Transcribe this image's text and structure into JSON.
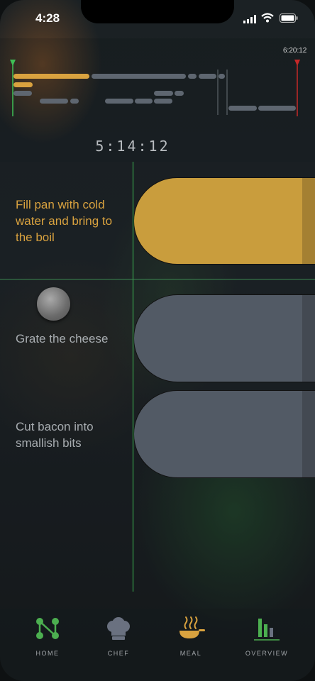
{
  "status_bar": {
    "time": "4:28"
  },
  "timeline": {
    "end_label": "6:20:12",
    "elapsed": "5:14:12",
    "colors": {
      "start_marker": "#3fbf55",
      "end_marker": "#c62828",
      "active_bar": "#d9a23f",
      "pending_bar": "#5e6670"
    }
  },
  "tasks": [
    {
      "label": "Fill pan with cold water and bring to the boil",
      "state": "active",
      "color": "#c99d3d"
    },
    {
      "label": "Grate the cheese",
      "state": "pending",
      "color": "#525a65"
    },
    {
      "label": "Cut bacon into smallish bits",
      "state": "pending",
      "color": "#525a65"
    }
  ],
  "tabbar": {
    "items": [
      {
        "label": "HOME",
        "icon": "network-nodes-icon"
      },
      {
        "label": "CHEF",
        "icon": "chef-hat-icon"
      },
      {
        "label": "MEAL",
        "icon": "steaming-pan-icon"
      },
      {
        "label": "OVERVIEW",
        "icon": "bar-chart-icon"
      }
    ]
  }
}
